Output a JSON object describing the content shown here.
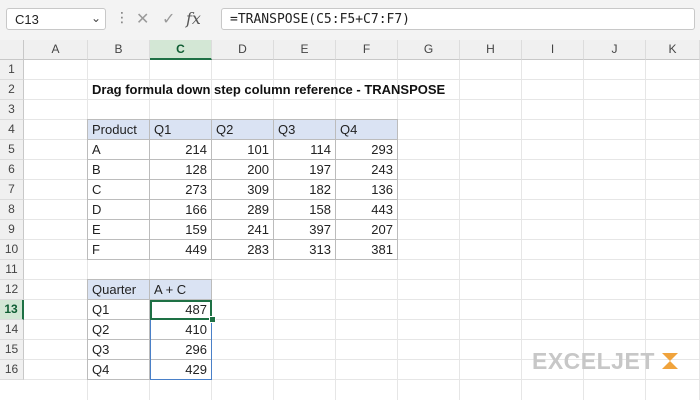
{
  "formula_bar": {
    "name_box": "C13",
    "formula": "=TRANSPOSE(C5:F5+C7:F7)",
    "fx_label": "fx"
  },
  "columns": [
    "A",
    "B",
    "C",
    "D",
    "E",
    "F",
    "G",
    "H",
    "I",
    "J",
    "K"
  ],
  "rows": [
    "1",
    "2",
    "3",
    "4",
    "5",
    "6",
    "7",
    "8",
    "9",
    "10",
    "11",
    "12",
    "13",
    "14",
    "15",
    "16"
  ],
  "selected_column": "C",
  "selected_row": "13",
  "title": "Drag formula down step column reference - TRANSPOSE",
  "table1": {
    "headers": [
      "Product",
      "Q1",
      "Q2",
      "Q3",
      "Q4"
    ],
    "rows": [
      [
        "A",
        "214",
        "101",
        "114",
        "293"
      ],
      [
        "B",
        "128",
        "200",
        "197",
        "243"
      ],
      [
        "C",
        "273",
        "309",
        "182",
        "136"
      ],
      [
        "D",
        "166",
        "289",
        "158",
        "443"
      ],
      [
        "E",
        "159",
        "241",
        "397",
        "207"
      ],
      [
        "F",
        "449",
        "283",
        "313",
        "381"
      ]
    ]
  },
  "table2": {
    "headers": [
      "Quarter",
      "A + C"
    ],
    "rows": [
      [
        "Q1",
        "487"
      ],
      [
        "Q2",
        "410"
      ],
      [
        "Q3",
        "296"
      ],
      [
        "Q4",
        "429"
      ]
    ]
  },
  "branding": {
    "logo_text": "EXCELJET",
    "accent_color": "#f0a33c"
  }
}
